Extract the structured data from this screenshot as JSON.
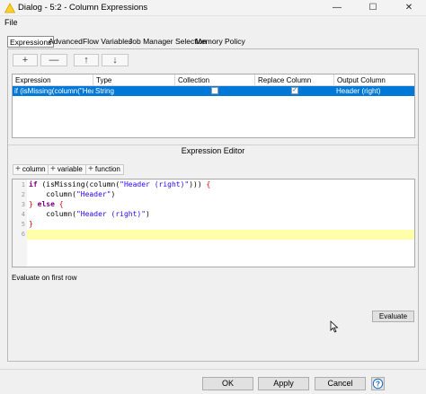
{
  "window": {
    "title": "Dialog - 5:2 - Column Expressions",
    "minimize": "—",
    "maximize": "☐",
    "close": "✕"
  },
  "menu": {
    "file": "File"
  },
  "tabs": [
    {
      "label": "Expressions",
      "active": true
    },
    {
      "label": "Advanced"
    },
    {
      "label": "Flow Variables"
    },
    {
      "label": "Job Manager Selection"
    },
    {
      "label": "Memory Policy"
    }
  ],
  "toolbar": {
    "add": "+",
    "remove": "—",
    "up": "↑",
    "down": "↓"
  },
  "table": {
    "headers": [
      "Expression",
      "Type",
      "Collection",
      "Replace Column",
      "Output Column"
    ],
    "rows": [
      {
        "expression": "if (isMissing(column(\"Head...",
        "type": "String",
        "collection": false,
        "replace_column": true,
        "output_column": "Header (right)",
        "selected": true
      }
    ]
  },
  "editor": {
    "title": "Expression Editor",
    "insert_buttons": [
      "column",
      "variable",
      "function"
    ],
    "line_numbers": [
      "1",
      "2",
      "3",
      "4",
      "5",
      "6"
    ],
    "code": {
      "l1_kw": "if",
      "l1_a": " (isMissing(column(",
      "l1_str": "\"Header (right)\"",
      "l1_b": "))) ",
      "l1_brace": "{",
      "l2_a": "    column(",
      "l2_str": "\"Header\"",
      "l2_b": ")",
      "l3_brace": "}",
      "l3_kw": " else ",
      "l3_brace2": "{",
      "l4_a": "    column(",
      "l4_str": "\"Header (right)\"",
      "l4_b": ")",
      "l5_brace": "}"
    },
    "current_line": 6
  },
  "evaluate": {
    "label": "Evaluate on first row",
    "button": "Evaluate"
  },
  "footer": {
    "ok": "OK",
    "apply": "Apply",
    "cancel": "Cancel",
    "help": "?"
  },
  "colors": {
    "selection": "#0078d7",
    "current_line": "#ffffaa",
    "keyword": "#7a0080",
    "string": "#2a00ff",
    "brace": "#d50000"
  }
}
